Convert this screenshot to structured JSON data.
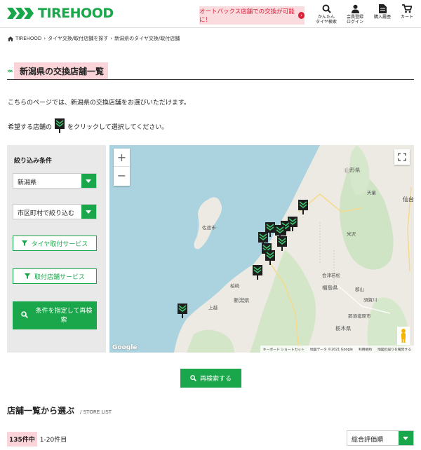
{
  "header": {
    "logo": "TIREHOOD",
    "promo": "オートバックス店舗での交換が可能に！",
    "promo_arrow": "›",
    "icons": [
      {
        "name": "search",
        "label1": "かんたん",
        "label2": "タイヤ検索"
      },
      {
        "name": "user",
        "label1": "会員登録",
        "label2": "ログイン"
      },
      {
        "name": "history",
        "label1": "購入履歴",
        "label2": ""
      },
      {
        "name": "cart",
        "label1": "カート",
        "label2": ""
      }
    ]
  },
  "breadcrumb": {
    "home": "TIREHOOD",
    "sep": "›",
    "item1": "タイヤ交換/取付店舗を探す",
    "item2": "新潟県のタイヤ交換/取付店舗"
  },
  "page": {
    "title": "新潟県の交換店舗一覧",
    "desc1": "こちらのページでは、新潟県の交換店舗をお選びいただけます。",
    "desc2_pre": "希望する店舗の",
    "desc2_post": "をクリックして選択してください。"
  },
  "filter": {
    "title": "絞り込み条件",
    "prefecture": "新潟県",
    "city_placeholder": "市区町村で絞り込む",
    "tire_service": "タイヤ取付サービス",
    "shop_service": "取付店舗サービス",
    "search_btn": "条件を指定して再検索"
  },
  "map": {
    "zoom_in": "+",
    "zoom_out": "−",
    "google": "Google",
    "footer": [
      "キーボード ショートカット",
      "地図データ ©2021 Google",
      "利用規約",
      "地図の誤りを報告する"
    ],
    "labels": [
      {
        "name": "sado",
        "text": "佐渡市"
      },
      {
        "name": "yamagata",
        "text": "山形県"
      },
      {
        "name": "fukushima",
        "text": "福島県"
      },
      {
        "name": "niigata",
        "text": "新潟県"
      },
      {
        "name": "sendai",
        "text": "仙台"
      },
      {
        "name": "tendo",
        "text": "天童"
      },
      {
        "name": "yonezawa",
        "text": "米沢"
      },
      {
        "name": "aizu",
        "text": "会津若松"
      },
      {
        "name": "koriyama",
        "text": "郡山"
      },
      {
        "name": "sukagawa",
        "text": "須賀川"
      },
      {
        "name": "tochigi",
        "text": "栃木県"
      },
      {
        "name": "kashiwazaki",
        "text": "柏崎"
      },
      {
        "name": "joetsu",
        "text": "上越"
      },
      {
        "name": "nasushiobara",
        "text": "那須塩原市"
      }
    ]
  },
  "research_btn": "再検索する",
  "store_list": {
    "title": "店舗一覧から選ぶ",
    "sub": "/ STORE LIST",
    "count_badge": "135件中",
    "count_range": "1-20件目",
    "sort": "総合評価順"
  },
  "colors": {
    "brand": "#1aa64a",
    "highlight": "#fad4d8",
    "promo": "#d8203a"
  }
}
